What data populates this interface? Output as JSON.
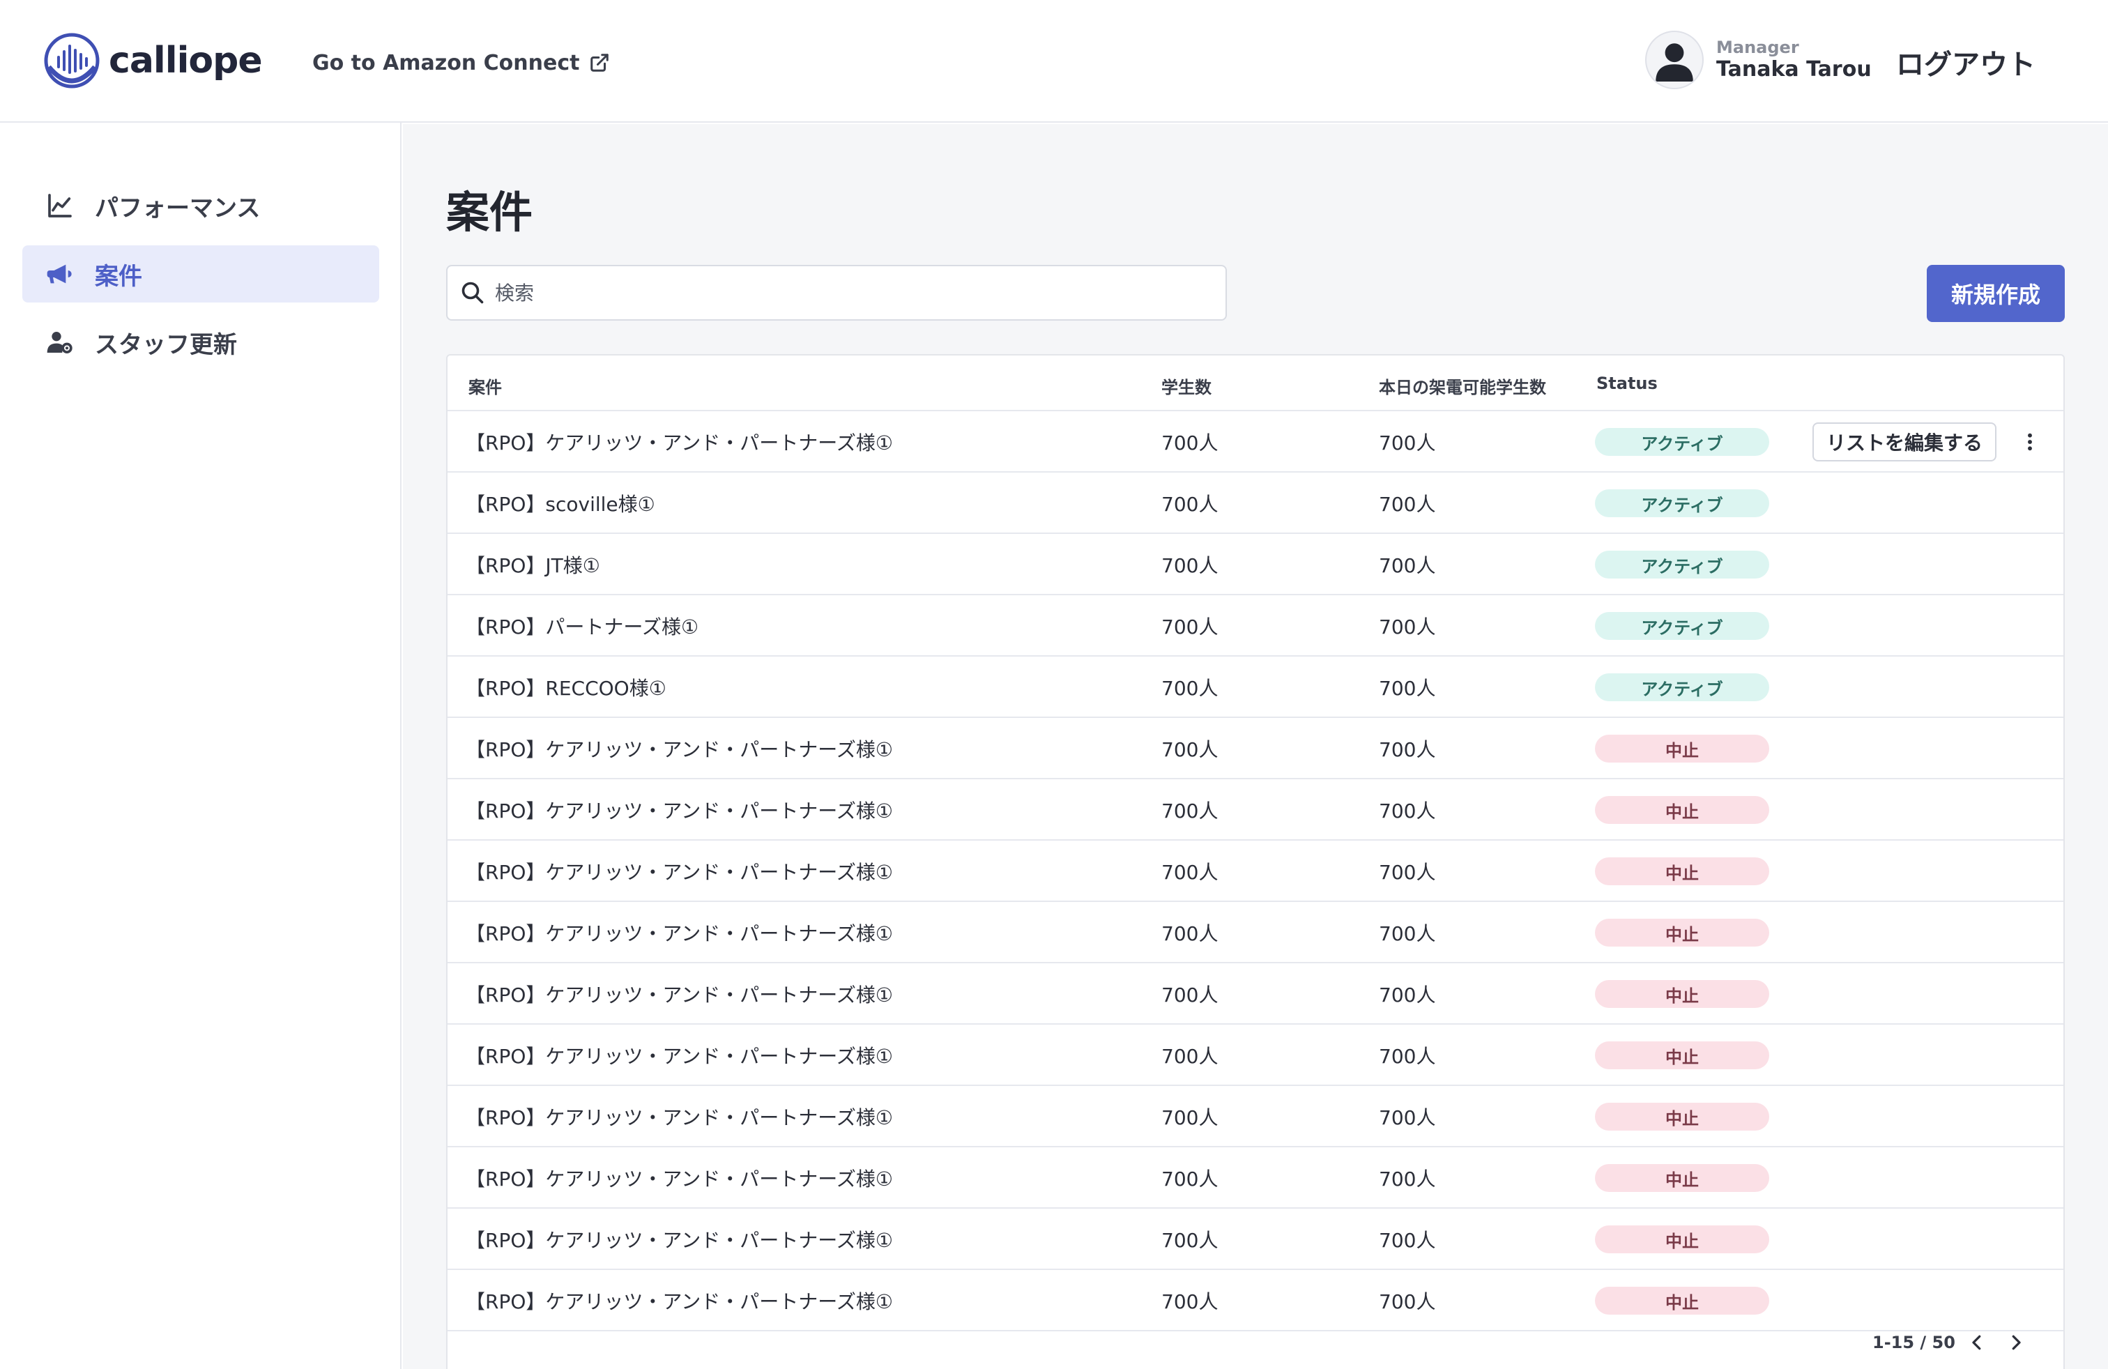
{
  "header": {
    "logo_text": "calliope",
    "connect_link": "Go to Amazon Connect",
    "user_role": "Manager",
    "user_name": "Tanaka Tarou",
    "logout": "ログアウト"
  },
  "sidebar": {
    "items": [
      {
        "label": "パフォーマンス",
        "icon": "chart-line-icon",
        "active": false
      },
      {
        "label": "案件",
        "icon": "megaphone-icon",
        "active": true
      },
      {
        "label": "スタッフ更新",
        "icon": "user-gear-icon",
        "active": false
      }
    ]
  },
  "main": {
    "title": "案件",
    "search_placeholder": "検索",
    "new_button": "新規作成"
  },
  "table": {
    "headers": {
      "name": "案件",
      "students": "学生数",
      "callable": "本日の架電可能学生数",
      "status": "Status"
    },
    "edit_button": "リストを編集する",
    "rows": [
      {
        "name": "【RPO】ケアリッツ・アンド・パートナーズ様①",
        "students": "700人",
        "callable": "700人",
        "status": "アクティブ",
        "status_type": "active"
      },
      {
        "name": "【RPO】scoville様①",
        "students": "700人",
        "callable": "700人",
        "status": "アクティブ",
        "status_type": "active"
      },
      {
        "name": "【RPO】JT様①",
        "students": "700人",
        "callable": "700人",
        "status": "アクティブ",
        "status_type": "active"
      },
      {
        "name": "【RPO】パートナーズ様①",
        "students": "700人",
        "callable": "700人",
        "status": "アクティブ",
        "status_type": "active"
      },
      {
        "name": "【RPO】RECCOO様①",
        "students": "700人",
        "callable": "700人",
        "status": "アクティブ",
        "status_type": "active"
      },
      {
        "name": "【RPO】ケアリッツ・アンド・パートナーズ様①",
        "students": "700人",
        "callable": "700人",
        "status": "中止",
        "status_type": "stopped"
      },
      {
        "name": "【RPO】ケアリッツ・アンド・パートナーズ様①",
        "students": "700人",
        "callable": "700人",
        "status": "中止",
        "status_type": "stopped"
      },
      {
        "name": "【RPO】ケアリッツ・アンド・パートナーズ様①",
        "students": "700人",
        "callable": "700人",
        "status": "中止",
        "status_type": "stopped"
      },
      {
        "name": "【RPO】ケアリッツ・アンド・パートナーズ様①",
        "students": "700人",
        "callable": "700人",
        "status": "中止",
        "status_type": "stopped"
      },
      {
        "name": "【RPO】ケアリッツ・アンド・パートナーズ様①",
        "students": "700人",
        "callable": "700人",
        "status": "中止",
        "status_type": "stopped"
      },
      {
        "name": "【RPO】ケアリッツ・アンド・パートナーズ様①",
        "students": "700人",
        "callable": "700人",
        "status": "中止",
        "status_type": "stopped"
      },
      {
        "name": "【RPO】ケアリッツ・アンド・パートナーズ様①",
        "students": "700人",
        "callable": "700人",
        "status": "中止",
        "status_type": "stopped"
      },
      {
        "name": "【RPO】ケアリッツ・アンド・パートナーズ様①",
        "students": "700人",
        "callable": "700人",
        "status": "中止",
        "status_type": "stopped"
      },
      {
        "name": "【RPO】ケアリッツ・アンド・パートナーズ様①",
        "students": "700人",
        "callable": "700人",
        "status": "中止",
        "status_type": "stopped"
      },
      {
        "name": "【RPO】ケアリッツ・アンド・パートナーズ様①",
        "students": "700人",
        "callable": "700人",
        "status": "中止",
        "status_type": "stopped"
      }
    ],
    "pagination": "1-15 / 50"
  },
  "colors": {
    "accent": "#5266cc",
    "nav_active_bg": "#e8ebfb",
    "badge_active_bg": "#dcf5f1",
    "badge_stopped_bg": "#fbe0e6"
  }
}
